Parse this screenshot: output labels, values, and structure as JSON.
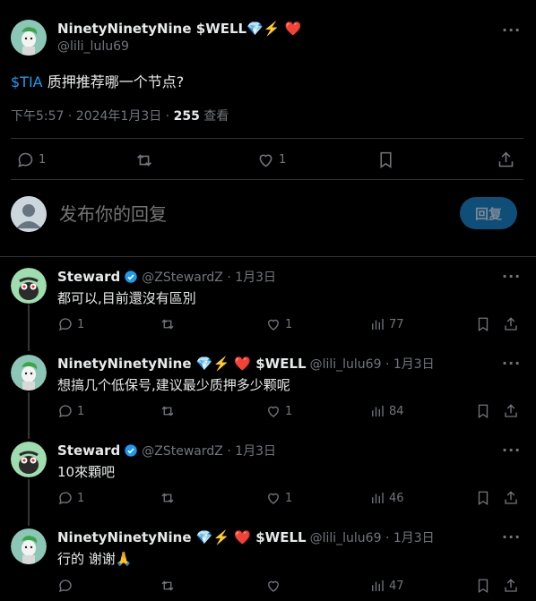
{
  "main_post": {
    "name": "NinetyNinetyNine $WELL💎⚡️ ❤️",
    "handle": "@lili_lulu69",
    "cashtag": "$TIA",
    "text": "质押推荐哪一个节点?",
    "time": "下午5:57 · 2024年1月3日 · ",
    "views_count": "255",
    "views_label": " 查看",
    "reply_count": "1",
    "like_count": "1"
  },
  "reply_box": {
    "placeholder": "发布你的回复",
    "button_label": "回复"
  },
  "replies": [
    {
      "name": "Steward",
      "handle": "@ZStewardZ · 1月3日",
      "text": "都可以,目前還沒有區別",
      "reply_count": "1",
      "retweet_count": "",
      "like_count": "1",
      "views": "77",
      "verified": true
    },
    {
      "name": "NinetyNinetyNine 💎⚡️ ❤️ $WELL",
      "handle": "@lili_lulu69 · 1月3日",
      "text": "想搞几个低保号,建议最少质押多少颗呢",
      "reply_count": "1",
      "retweet_count": "",
      "like_count": "1",
      "views": "84",
      "verified": false
    },
    {
      "name": "Steward",
      "handle": "@ZStewardZ · 1月3日",
      "text": "10來顆吧",
      "reply_count": "1",
      "retweet_count": "",
      "like_count": "1",
      "views": "46",
      "verified": true
    },
    {
      "name": "NinetyNinetyNine 💎⚡️ ❤️ $WELL",
      "handle": "@lili_lulu69 · 1月3日",
      "text": "行的 谢谢🙏",
      "reply_count": "",
      "retweet_count": "",
      "like_count": "",
      "views": "47",
      "verified": false
    }
  ],
  "colors": {
    "background": "#000000",
    "accent": "#1d9bf0",
    "secondary_text": "#71767b",
    "divider": "#2f3336"
  }
}
